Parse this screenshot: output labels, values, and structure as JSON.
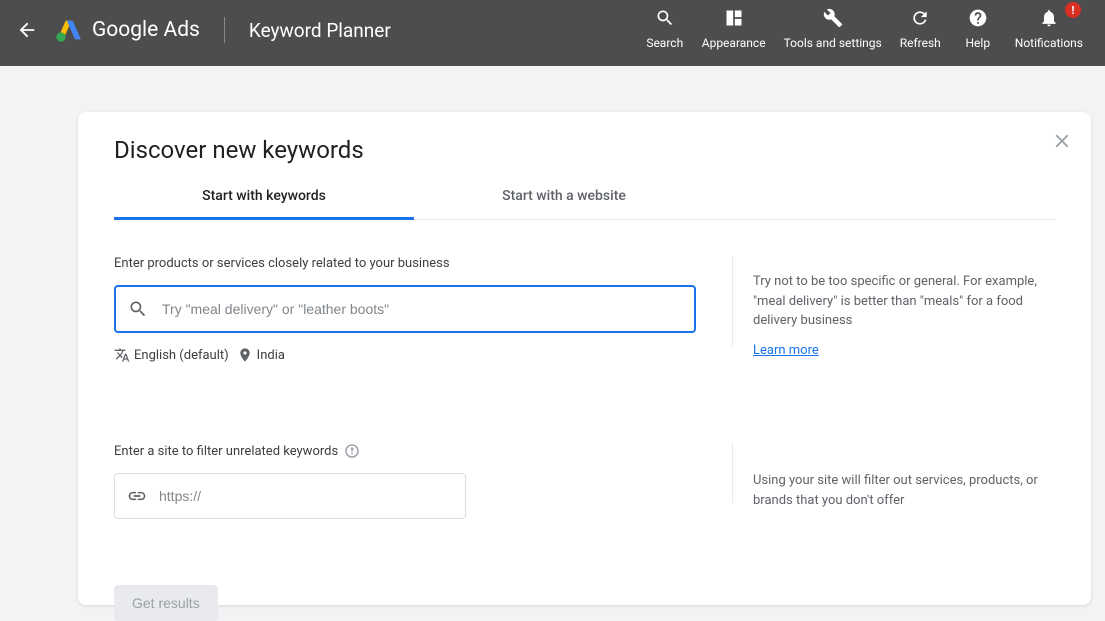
{
  "header": {
    "product": "Google Ads",
    "page": "Keyword Planner",
    "nav": {
      "search": "Search",
      "appearance": "Appearance",
      "tools": "Tools and settings",
      "refresh": "Refresh",
      "help": "Help",
      "notifications": "Notifications"
    },
    "notif_badge": "!"
  },
  "card": {
    "title": "Discover new keywords",
    "tabs": {
      "keywords": "Start with keywords",
      "website": "Start with a website"
    },
    "keyword_section": {
      "label": "Enter products or services closely related to your business",
      "placeholder": "Try \"meal delivery\" or \"leather boots\"",
      "language": "English (default)",
      "location": "India",
      "tip": "Try not to be too specific or general. For example, \"meal delivery\" is better than \"meals\" for a food delivery business",
      "learn_more": "Learn more"
    },
    "site_section": {
      "label": "Enter a site to filter unrelated keywords",
      "placeholder": "https://",
      "tip": "Using your site will filter out services, products, or brands that you don't offer"
    },
    "button": "Get results"
  }
}
